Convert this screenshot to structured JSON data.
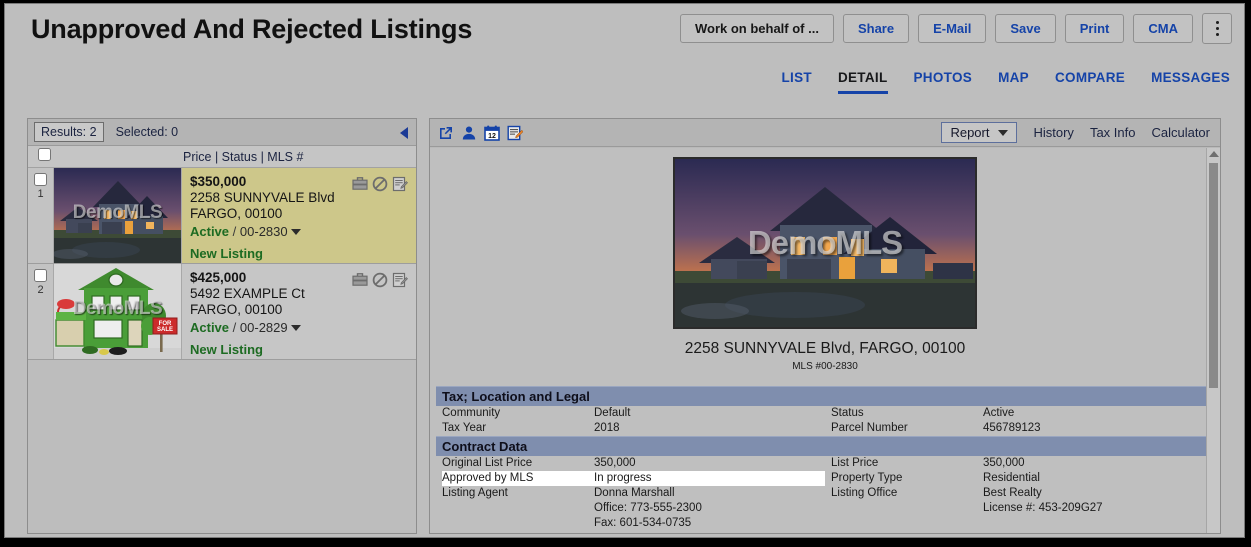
{
  "header": {
    "title": "Unapproved And Rejected Listings",
    "actions": [
      {
        "label": "Work on behalf of ...",
        "style": "dark",
        "name": "work-on-behalf-of-button"
      },
      {
        "label": "Share",
        "style": "link",
        "name": "share-button"
      },
      {
        "label": "E-Mail",
        "style": "link",
        "name": "email-button"
      },
      {
        "label": "Save",
        "style": "link",
        "name": "save-button"
      },
      {
        "label": "Print",
        "style": "link",
        "name": "print-button"
      },
      {
        "label": "CMA",
        "style": "link",
        "name": "cma-button"
      }
    ],
    "overflow_icon": "kebab-menu-icon"
  },
  "tabs": [
    {
      "label": "LIST",
      "active": false
    },
    {
      "label": "DETAIL",
      "active": true
    },
    {
      "label": "PHOTOS",
      "active": false
    },
    {
      "label": "MAP",
      "active": false
    },
    {
      "label": "COMPARE",
      "active": false
    },
    {
      "label": "MESSAGES",
      "active": false
    }
  ],
  "left_panel": {
    "results_chip": "Results: 2",
    "selected_label": "Selected: 0",
    "collapse_icon": "caret-left-icon",
    "column_headers": "Price  |  Status  |  MLS #",
    "listings": [
      {
        "number": "1",
        "price": "$350,000",
        "address": "2258 SUNNYVALE Blvd",
        "city_zip": "FARGO, 00100",
        "status": "Active",
        "separator": "/",
        "mls": "00-2830",
        "flag": "New Listing",
        "watermark": "DemoMLS",
        "selected": true,
        "photo_style": "dusk-house-photo",
        "icons": [
          "briefcase-icon",
          "prohibited-icon",
          "edit-document-icon"
        ]
      },
      {
        "number": "2",
        "price": "$425,000",
        "address": "5492 EXAMPLE Ct",
        "city_zip": "FARGO, 00100",
        "status": "Active",
        "separator": "/",
        "mls": "00-2829",
        "flag": "New Listing",
        "watermark": "DemoMLS",
        "selected": false,
        "photo_style": "green-house-illustration",
        "icons": [
          "briefcase-icon",
          "prohibited-icon",
          "edit-document-icon"
        ]
      }
    ]
  },
  "right_panel": {
    "toolbar_icons": [
      "external-link-icon",
      "person-icon",
      "calendar-icon",
      "edit-note-icon"
    ],
    "calendar_day": "12",
    "report_button": "Report",
    "links": [
      {
        "label": "History"
      },
      {
        "label": "Tax Info"
      },
      {
        "label": "Calculator"
      }
    ],
    "photo_watermark": "DemoMLS",
    "property_address": "2258 SUNNYVALE Blvd, FARGO, 00100",
    "property_mls": "MLS #00-2830",
    "sections": [
      {
        "title": "Tax; Location and Legal",
        "rows": [
          {
            "left": {
              "label": "Community",
              "value": "Default",
              "highlight": false
            },
            "right": {
              "label": "Status",
              "value": "Active",
              "highlight": false
            }
          },
          {
            "left": {
              "label": "Tax Year",
              "value": "2018",
              "highlight": false
            },
            "right": {
              "label": "Parcel Number",
              "value": "456789123",
              "highlight": false
            }
          }
        ]
      },
      {
        "title": "Contract Data",
        "rows": [
          {
            "left": {
              "label": "Original List Price",
              "value": "350,000",
              "highlight": false
            },
            "right": {
              "label": "List Price",
              "value": "350,000",
              "highlight": false
            }
          },
          {
            "left": {
              "label": "Approved by MLS",
              "value": "In progress",
              "highlight": true
            },
            "right": {
              "label": "Property Type",
              "value": "Residential",
              "highlight": false
            }
          },
          {
            "left": {
              "label": "Listing Agent",
              "value": "Donna Marshall",
              "sub1": "Office: 773-555-2300",
              "sub2": "Fax: 601-534-0735",
              "highlight": false
            },
            "right": {
              "label": "Listing Office",
              "value": "Best Realty",
              "sub1": "License #: 453-209G27",
              "highlight": false
            }
          }
        ]
      }
    ],
    "scrollbar": {
      "up_arrow": "caret-up-icon"
    }
  },
  "colors": {
    "accent_blue": "#1543a8",
    "section_header": "#7f8eae",
    "selected_row": "#cdc78a",
    "status_green": "#1d6b22",
    "app_bg": "#bebebe"
  }
}
